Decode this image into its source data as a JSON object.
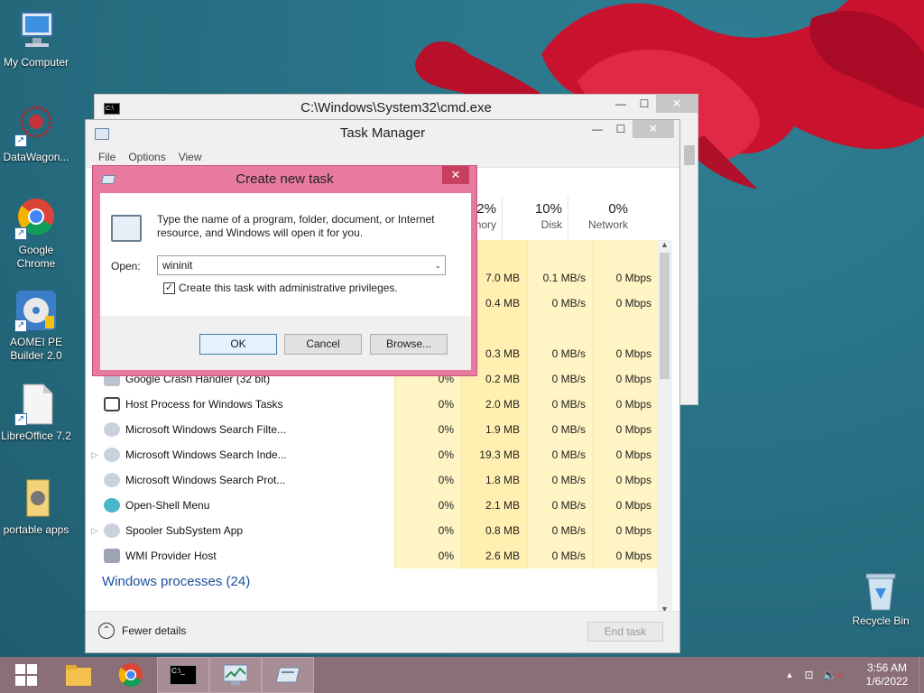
{
  "desktop": {
    "icons": [
      {
        "label": "My Computer"
      },
      {
        "label": "DataWagon..."
      },
      {
        "label": "Google Chrome"
      },
      {
        "label": "AOMEI PE Builder 2.0"
      },
      {
        "label": "LibreOffice 7.2"
      },
      {
        "label": "portable apps"
      }
    ],
    "recycle_bin": "Recycle Bin"
  },
  "cmd_window": {
    "title": "C:\\Windows\\System32\\cmd.exe"
  },
  "task_manager": {
    "title": "Task Manager",
    "menu": [
      "File",
      "Options",
      "View"
    ],
    "columns": [
      {
        "pct": "12%",
        "label": "Memory"
      },
      {
        "pct": "10%",
        "label": "Disk"
      },
      {
        "pct": "0%",
        "label": "Network"
      }
    ],
    "hidden_rows": [
      {
        "mem": "7.0 MB",
        "disk": "0.1 MB/s",
        "net": "0 Mbps"
      },
      {
        "mem": "0.4 MB",
        "disk": "0 MB/s",
        "net": "0 Mbps"
      },
      {
        "mem": "0.3 MB",
        "disk": "0 MB/s",
        "net": "0 Mbps"
      }
    ],
    "processes": [
      {
        "name": "Google Crash Handler (32 bit)",
        "cpu": "0%",
        "mem": "0.2 MB",
        "disk": "0 MB/s",
        "net": "0 Mbps",
        "expand": ""
      },
      {
        "name": "Host Process for Windows Tasks",
        "cpu": "0%",
        "mem": "2.0 MB",
        "disk": "0 MB/s",
        "net": "0 Mbps",
        "expand": ""
      },
      {
        "name": "Microsoft Windows Search Filte...",
        "cpu": "0%",
        "mem": "1.9 MB",
        "disk": "0 MB/s",
        "net": "0 Mbps",
        "expand": ""
      },
      {
        "name": "Microsoft Windows Search Inde...",
        "cpu": "0%",
        "mem": "19.3 MB",
        "disk": "0 MB/s",
        "net": "0 Mbps",
        "expand": "▷"
      },
      {
        "name": "Microsoft Windows Search Prot...",
        "cpu": "0%",
        "mem": "1.8 MB",
        "disk": "0 MB/s",
        "net": "0 Mbps",
        "expand": ""
      },
      {
        "name": "Open-Shell Menu",
        "cpu": "0%",
        "mem": "2.1 MB",
        "disk": "0 MB/s",
        "net": "0 Mbps",
        "expand": ""
      },
      {
        "name": "Spooler SubSystem App",
        "cpu": "0%",
        "mem": "0.8 MB",
        "disk": "0 MB/s",
        "net": "0 Mbps",
        "expand": "▷"
      },
      {
        "name": "WMI Provider Host",
        "cpu": "0%",
        "mem": "2.6 MB",
        "disk": "0 MB/s",
        "net": "0 Mbps",
        "expand": ""
      }
    ],
    "section": "Windows processes (24)",
    "fewer_details": "Fewer details",
    "end_task": "End task"
  },
  "dialog": {
    "title": "Create new task",
    "message": "Type the name of a program, folder, document, or Internet resource, and Windows will open it for you.",
    "open_label": "Open:",
    "open_value": "wininit",
    "checkbox_label": "Create this task with administrative privileges.",
    "checkbox_checked": true,
    "ok": "OK",
    "cancel": "Cancel",
    "browse": "Browse..."
  },
  "taskbar": {
    "time": "3:56 AM",
    "date": "1/6/2022"
  },
  "colors": {
    "dialog_frame": "#e87aa0",
    "taskbar": "#8b6f76",
    "cell_highlight": "#fff4c4"
  }
}
